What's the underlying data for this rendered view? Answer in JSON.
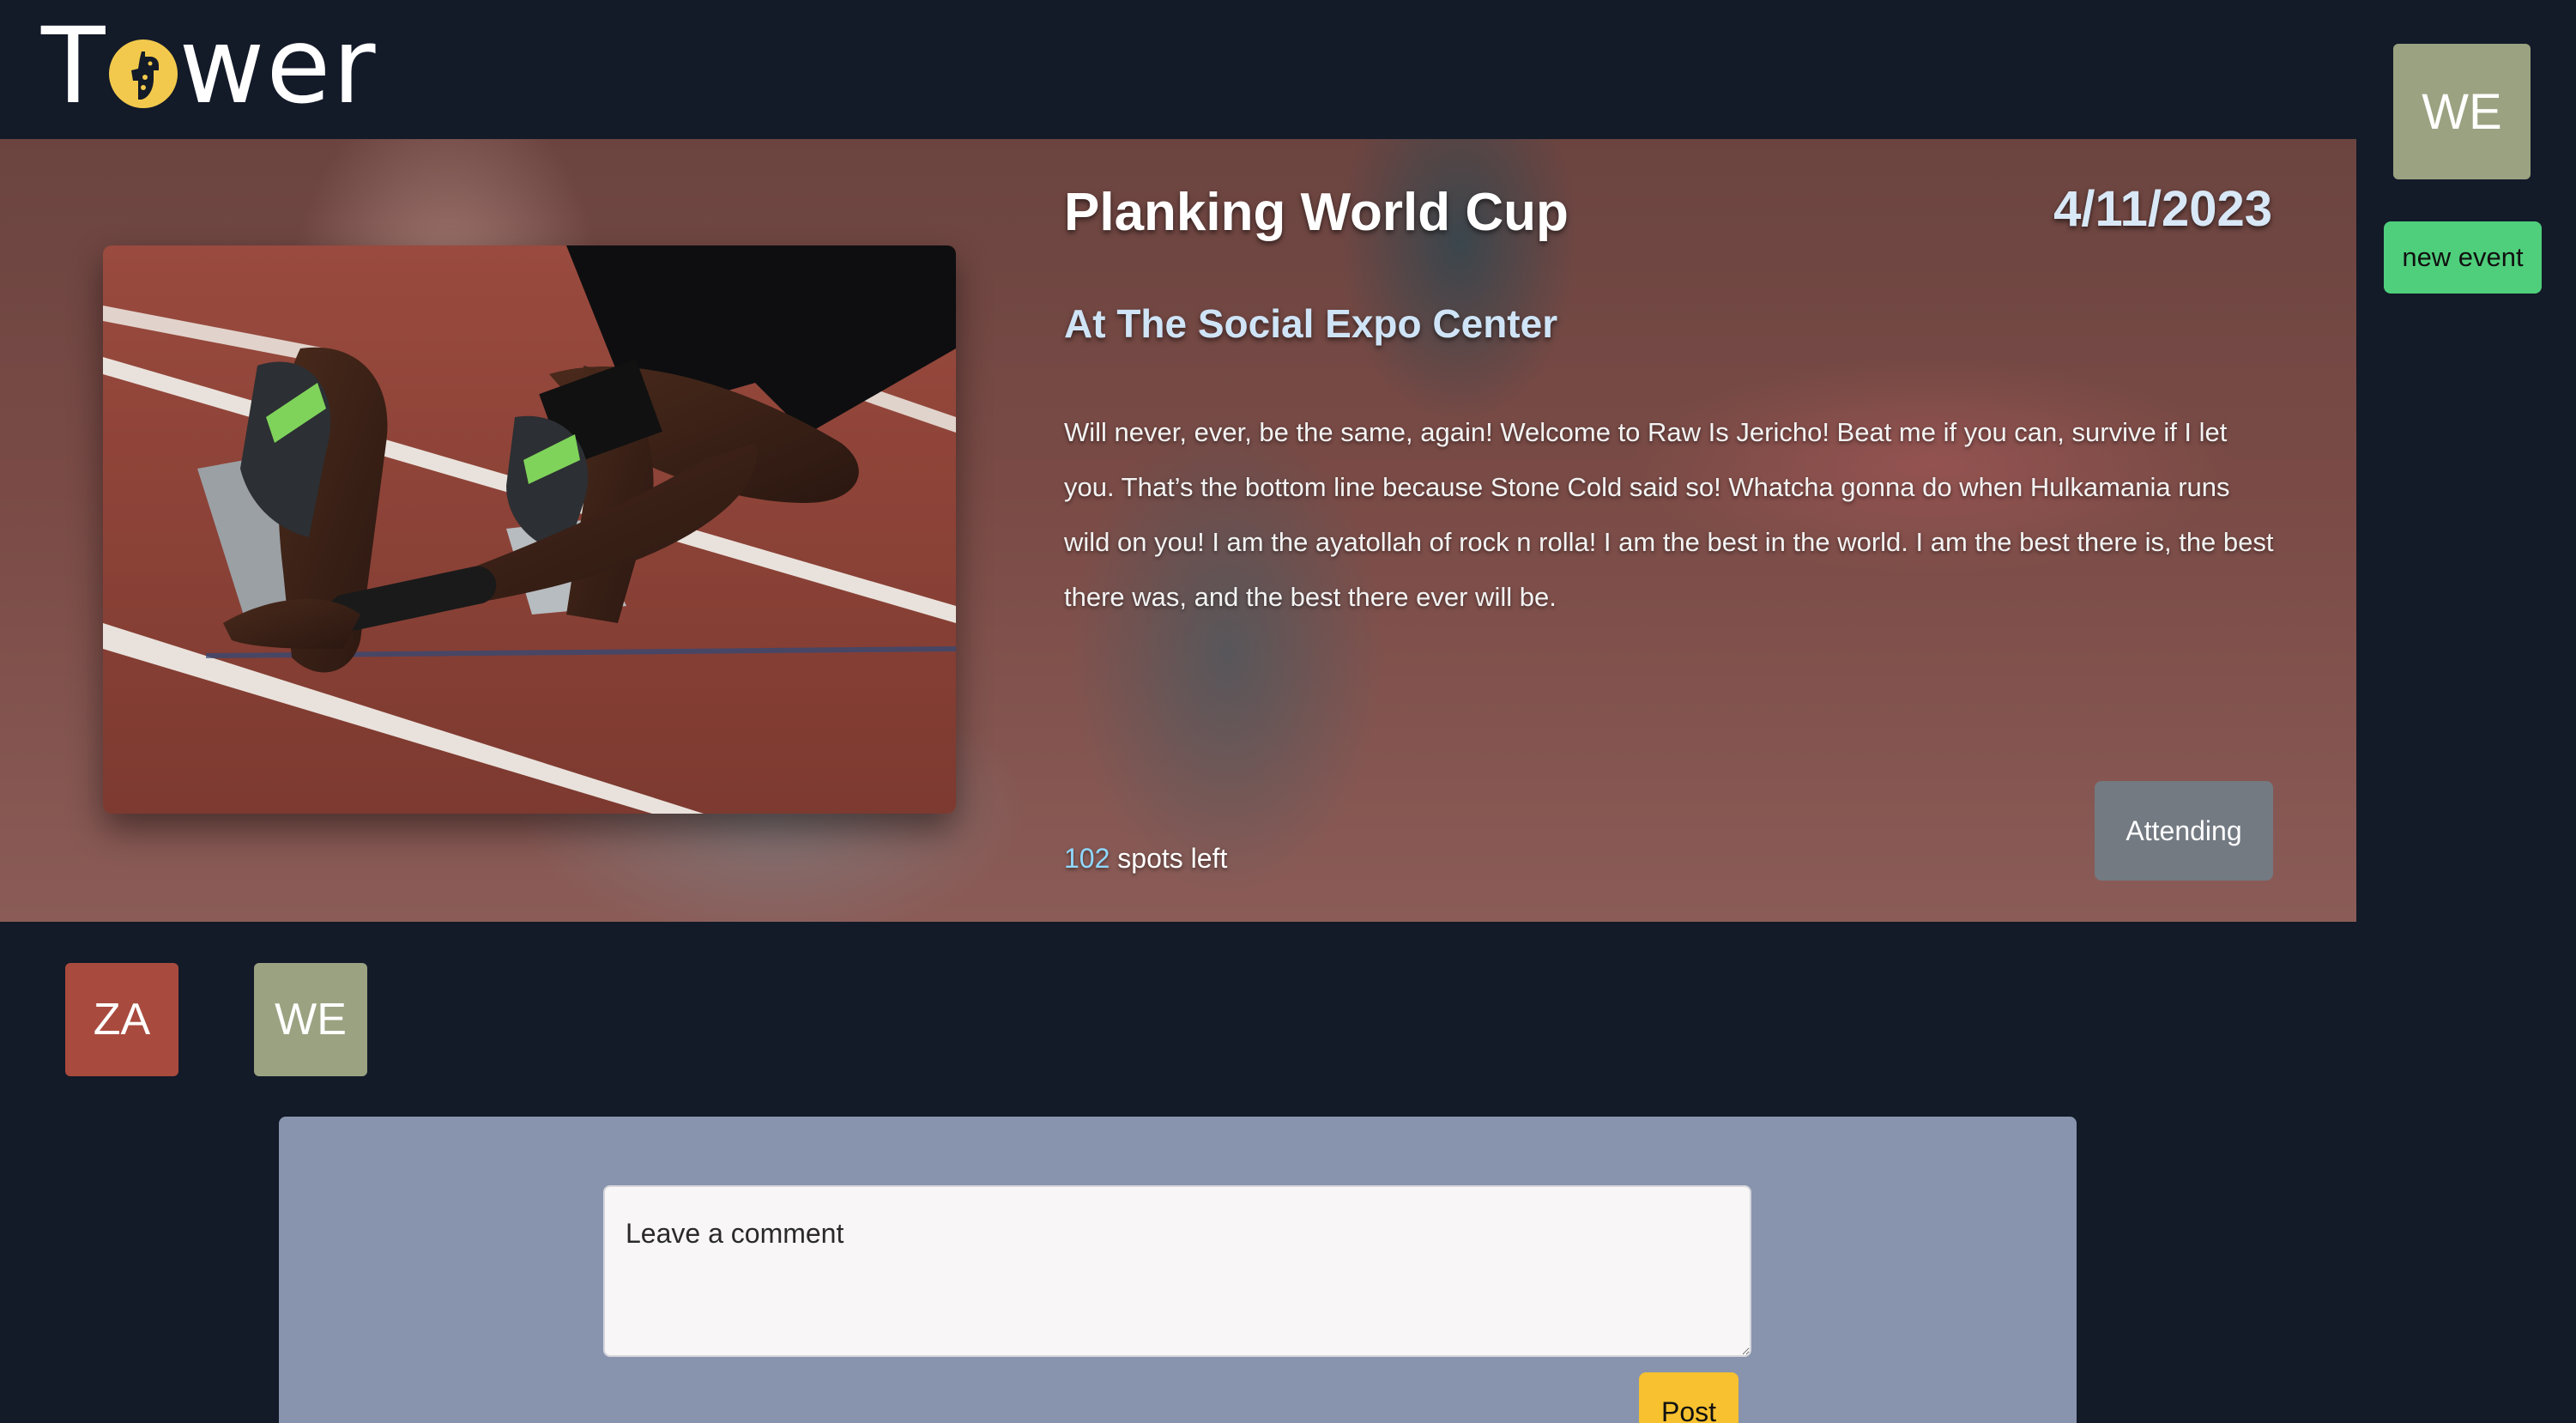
{
  "header": {
    "logo_text_prefix": "T",
    "logo_text_suffix": "wer"
  },
  "account": {
    "initials": "WE",
    "avatar_color": "#9ba281"
  },
  "actions": {
    "new_event_label": "new event"
  },
  "event": {
    "title": "Planking World Cup",
    "date": "4/11/2023",
    "location": "At The Social Expo Center",
    "description": "Will never, ever, be the same, again! Welcome to Raw Is Jericho! Beat me if you can, survive if I let you. That’s the bottom line because Stone Cold said so! Whatcha gonna do when Hulkamania runs wild on you! I am the ayatollah of rock n rolla! I am the best in the world. I am the best there is, the best there was, and the best there ever will be.",
    "spots_count": "102",
    "spots_label": " spots left",
    "attending_label": "Attending"
  },
  "attendees": [
    {
      "initials": "ZA",
      "color": "#a94a3e"
    },
    {
      "initials": "WE",
      "color": "#9ba281"
    }
  ],
  "comments": {
    "placeholder": "Leave a comment",
    "post_label": "Post"
  },
  "colors": {
    "background": "#131a28",
    "accent_green": "#4fcf7c",
    "accent_yellow": "#f7c12f",
    "panel": "#8894ad"
  }
}
